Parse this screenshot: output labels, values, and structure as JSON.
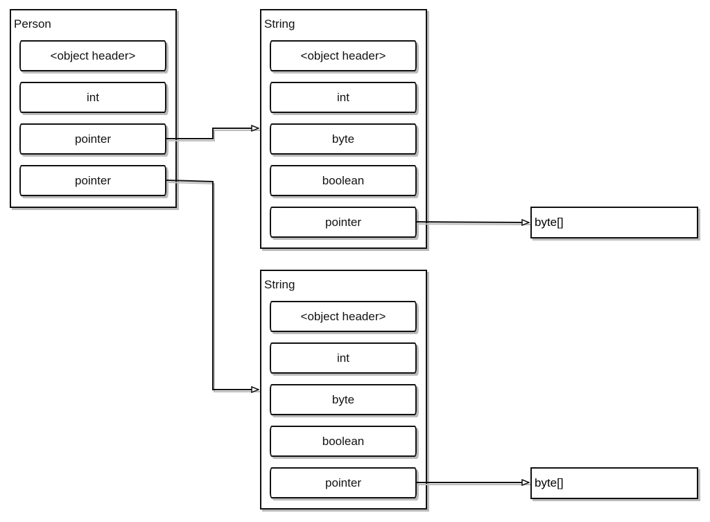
{
  "objects": [
    {
      "title": "Person",
      "fields": [
        "<object header>",
        "int",
        "pointer",
        "pointer"
      ]
    },
    {
      "title": "String",
      "fields": [
        "<object header>",
        "int",
        "byte",
        "boolean",
        "pointer"
      ]
    },
    {
      "title": "String",
      "fields": [
        "<object header>",
        "int",
        "byte",
        "boolean",
        "pointer"
      ]
    }
  ],
  "arrays": [
    {
      "title": "byte[]"
    },
    {
      "title": "byte[]"
    }
  ],
  "colors": {
    "stroke": "#111111",
    "shadow": "#bbbbbb"
  }
}
